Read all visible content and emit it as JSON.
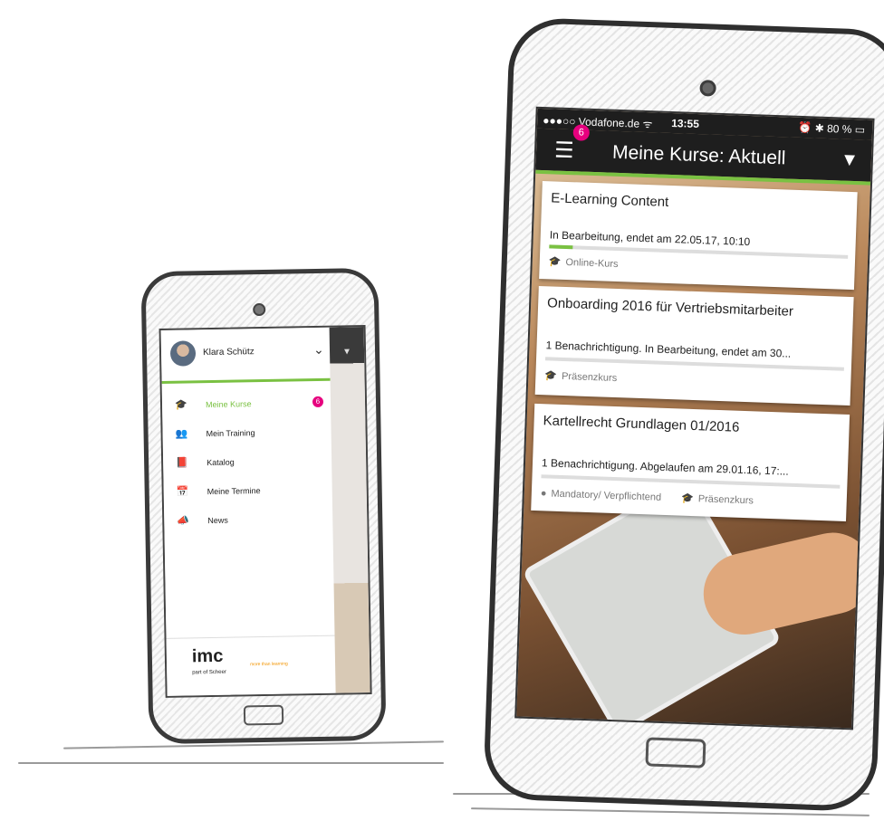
{
  "small_phone": {
    "user_name": "Klara Schütz",
    "menu": [
      {
        "label": "Meine Kurse",
        "icon": "graduation-cap-icon",
        "glyph": "🎓",
        "active": true,
        "badge": "6"
      },
      {
        "label": "Mein Training",
        "icon": "people-icon",
        "glyph": "👥",
        "active": false
      },
      {
        "label": "Katalog",
        "icon": "book-icon",
        "glyph": "📕",
        "active": false
      },
      {
        "label": "Meine Termine",
        "icon": "calendar-icon",
        "glyph": "📅",
        "active": false
      },
      {
        "label": "News",
        "icon": "megaphone-icon",
        "glyph": "📣",
        "active": false
      }
    ],
    "logo": {
      "brand": "imc",
      "sub": "part of Scheer",
      "tagline": "more than learning"
    }
  },
  "large_phone": {
    "status": {
      "carrier": "●●●○○ Vodafone.de ᯤ",
      "time": "13:55",
      "right": "⏰ ✱ 80 % ▭"
    },
    "title": "Meine Kurse: Aktuell",
    "notification_badge": "6",
    "cards": [
      {
        "title": "E-Learning Content",
        "status": "In Bearbeitung, endet am 22.05.17, 10:10",
        "progress": 0.08,
        "tags": [
          "Online-Kurs"
        ]
      },
      {
        "title": "Onboarding 2016 für Vertriebsmitarbeiter",
        "status": "1 Benachrichtigung. In Bearbeitung, endet am 30...",
        "progress": 0,
        "tags": [
          "Präsenzkurs"
        ]
      },
      {
        "title": "Kartellrecht Grundlagen 01/2016",
        "status": "1 Benachrichtigung. Abgelaufen am 29.01.16, 17:...",
        "progress": 0,
        "tags": [
          "Mandatory/ Verpflichtend",
          "Präsenzkurs"
        ]
      }
    ]
  },
  "colors": {
    "accent_green": "#7ac142",
    "badge_pink": "#e6007e",
    "appbar": "#1e1e1e",
    "logo_orange": "#f29400"
  }
}
